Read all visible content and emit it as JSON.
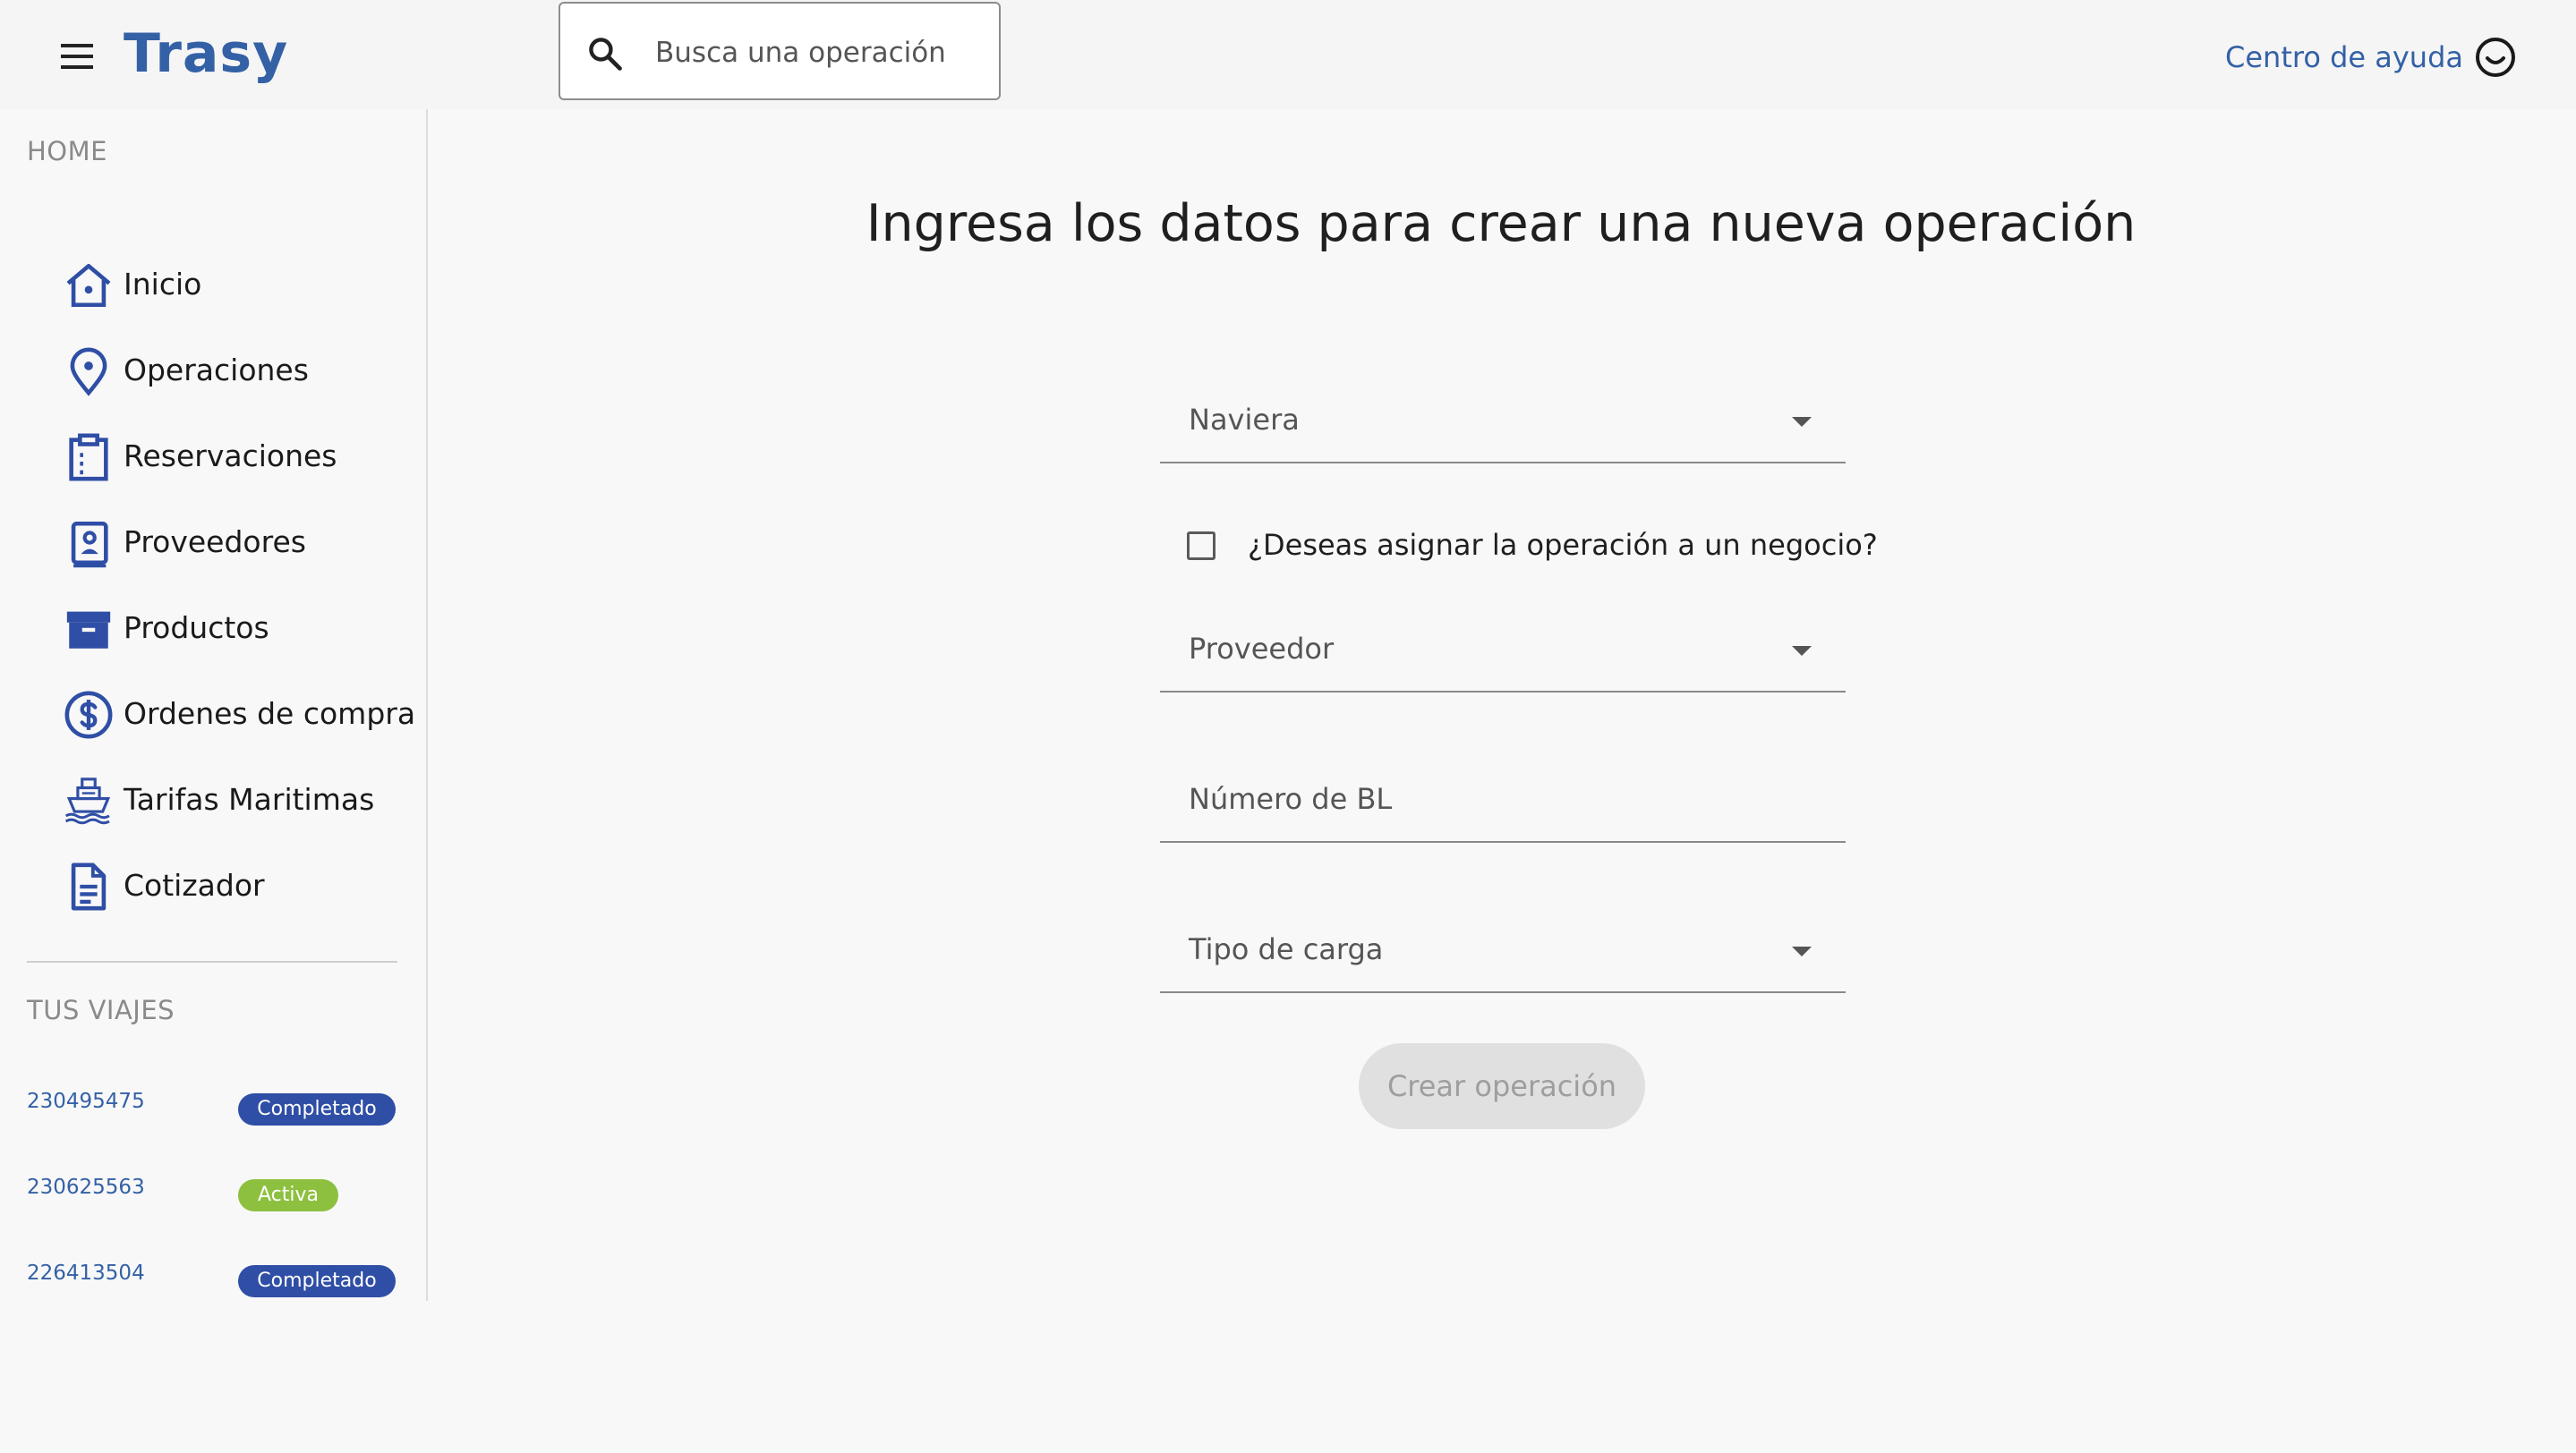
{
  "app": {
    "brand": "Trasy"
  },
  "header": {
    "search": {
      "placeholder": "Busca una operación",
      "value": ""
    },
    "help_link": "Centro de ayuda"
  },
  "sidebar": {
    "home_title": "HOME",
    "items": [
      {
        "label": "Inicio",
        "icon": "home-icon"
      },
      {
        "label": "Operaciones",
        "icon": "location-pin-icon"
      },
      {
        "label": "Reservaciones",
        "icon": "clipboard-icon"
      },
      {
        "label": "Proveedores",
        "icon": "contact-book-icon"
      },
      {
        "label": "Productos",
        "icon": "storefront-icon"
      },
      {
        "label": "Ordenes de compra",
        "icon": "dollar-circle-icon"
      },
      {
        "label": "Tarifas Maritimas",
        "icon": "ship-icon"
      },
      {
        "label": "Cotizador",
        "icon": "document-icon"
      }
    ],
    "trips_title": "TUS VIAJES",
    "trips": [
      {
        "id": "230495475",
        "status": "Completado",
        "status_color": "#2f4ea5"
      },
      {
        "id": "230625563",
        "status": "Activa",
        "status_color": "#8dc03f"
      },
      {
        "id": "226413504",
        "status": "Completado",
        "status_color": "#2f4ea5"
      }
    ]
  },
  "main": {
    "title": "Ingresa los datos para crear una nueva operación",
    "form": {
      "naviera_label": "Naviera",
      "assign_checkbox_label": "¿Deseas asignar la operación a un negocio?",
      "assign_checked": false,
      "proveedor_label": "Proveedor",
      "bl_label": "Número de BL",
      "tipo_carga_label": "Tipo de carga",
      "submit_label": "Crear operación",
      "submit_enabled": false
    }
  },
  "colors": {
    "brand_blue": "#3461a6",
    "icon_blue": "#2f4ea5",
    "active_green": "#8dc03f",
    "disabled_button": "#e0e0e0"
  }
}
